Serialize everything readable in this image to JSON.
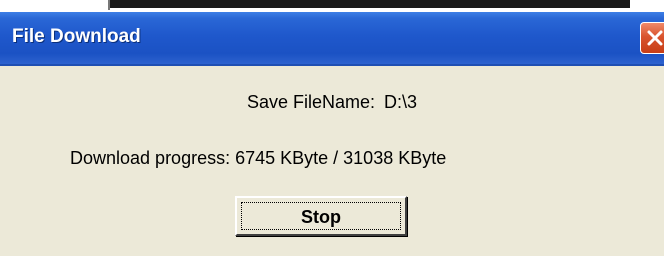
{
  "window": {
    "title": "File Download",
    "close_icon": "close-icon"
  },
  "dialog": {
    "filename_label": "Save FileName:",
    "filename_value": "D:\\3",
    "progress_text": "Download progress: 6745 KByte / 31038 KByte",
    "stop_label": "Stop"
  },
  "colors": {
    "titlebar": "#1f58cc",
    "dialog_bg": "#ece9d8",
    "close_button": "#d9542e"
  }
}
